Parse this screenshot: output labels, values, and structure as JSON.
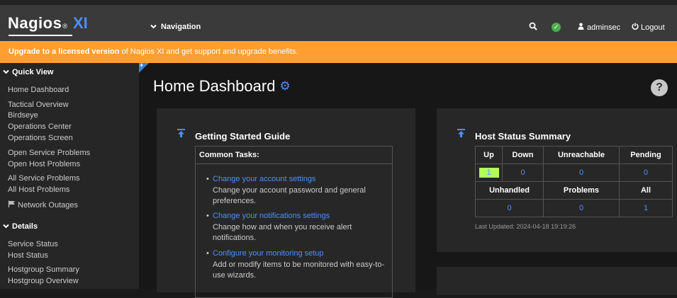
{
  "header": {
    "brand": "Nagios",
    "brand_reg": "®",
    "brand_suffix": "XI",
    "nav_label": "Navigation",
    "user": "adminsec",
    "logout": "Logout"
  },
  "banner": {
    "link_text": "Upgrade to a licensed version",
    "rest_text": " of Nagios XI and get support and upgrade benefits."
  },
  "sidebar": {
    "quick_view": {
      "label": "Quick View",
      "items": [
        "Home Dashboard",
        "Tactical Overview",
        "Birdseye",
        "Operations Center",
        "Operations Screen",
        "Open Service Problems",
        "Open Host Problems",
        "All Service Problems",
        "All Host Problems",
        "Network Outages"
      ]
    },
    "details": {
      "label": "Details",
      "items": [
        "Service Status",
        "Host Status",
        "Hostgroup Summary",
        "Hostgroup Overview"
      ]
    }
  },
  "main": {
    "title": "Home Dashboard",
    "help": "?"
  },
  "getting_started": {
    "title": "Getting Started Guide",
    "tasks_header": "Common Tasks:",
    "tasks": [
      {
        "link": "Change your account settings",
        "desc": "Change your account password and general preferences."
      },
      {
        "link": "Change your notifications settings",
        "desc": "Change how and when you receive alert notifications."
      },
      {
        "link": "Configure your monitoring setup",
        "desc": "Add or modify items to be monitored with easy-to-use wizards."
      }
    ]
  },
  "host_status": {
    "title": "Host Status Summary",
    "headers1": [
      "Up",
      "Down",
      "Unreachable",
      "Pending"
    ],
    "values1": [
      "1",
      "0",
      "0",
      "0"
    ],
    "headers2": [
      "Unhandled",
      "Problems",
      "All"
    ],
    "values2": [
      "0",
      "0",
      "1"
    ],
    "last_updated": "Last Updated: 2024-04-18 19:19:26"
  },
  "colors": {
    "accent": "#4d90fe",
    "banner": "#ff9f31",
    "ok": "#4caf50",
    "up_cell": "#b2ff59"
  }
}
